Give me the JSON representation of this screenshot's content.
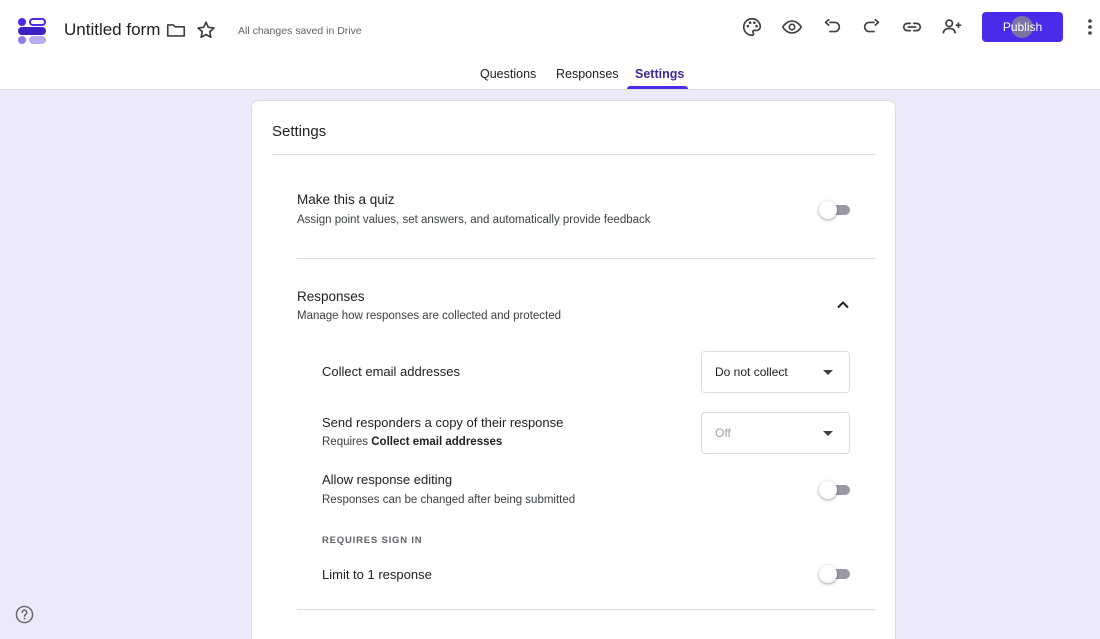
{
  "header": {
    "title": "Untitled form",
    "save_status": "All changes saved in Drive",
    "publish_label": "Publish",
    "icons": {
      "logo": "forms-logo-icon",
      "folder": "folder-icon",
      "star": "star-icon",
      "palette": "palette-icon",
      "preview": "eye-icon",
      "undo": "undo-icon",
      "redo": "redo-icon",
      "link": "link-icon",
      "add_collaborator": "person-add-icon",
      "more": "more-vert-icon"
    },
    "accent_color": "#4a2bea"
  },
  "tabs": [
    {
      "label": "Questions",
      "active": false
    },
    {
      "label": "Responses",
      "active": false
    },
    {
      "label": "Settings",
      "active": true
    }
  ],
  "settings": {
    "title": "Settings",
    "quiz": {
      "label": "Make this a quiz",
      "description": "Assign point values, set answers, and automatically provide feedback",
      "enabled": false
    },
    "responses": {
      "label": "Responses",
      "description": "Manage how responses are collected and protected",
      "expanded": true,
      "collect_email": {
        "label": "Collect email addresses",
        "value": "Do not collect"
      },
      "send_copy": {
        "label": "Send responders a copy of their response",
        "requires_prefix": "Requires",
        "requires_bold": "Collect email addresses",
        "value": "Off",
        "disabled": true
      },
      "allow_editing": {
        "label": "Allow response editing",
        "description": "Responses can be changed after being submitted",
        "enabled": false
      },
      "requires_sign_in_caption": "REQUIRES SIGN IN",
      "limit_one": {
        "label": "Limit to 1 response",
        "enabled": false
      }
    }
  },
  "footer": {
    "help_icon": "help-icon"
  }
}
